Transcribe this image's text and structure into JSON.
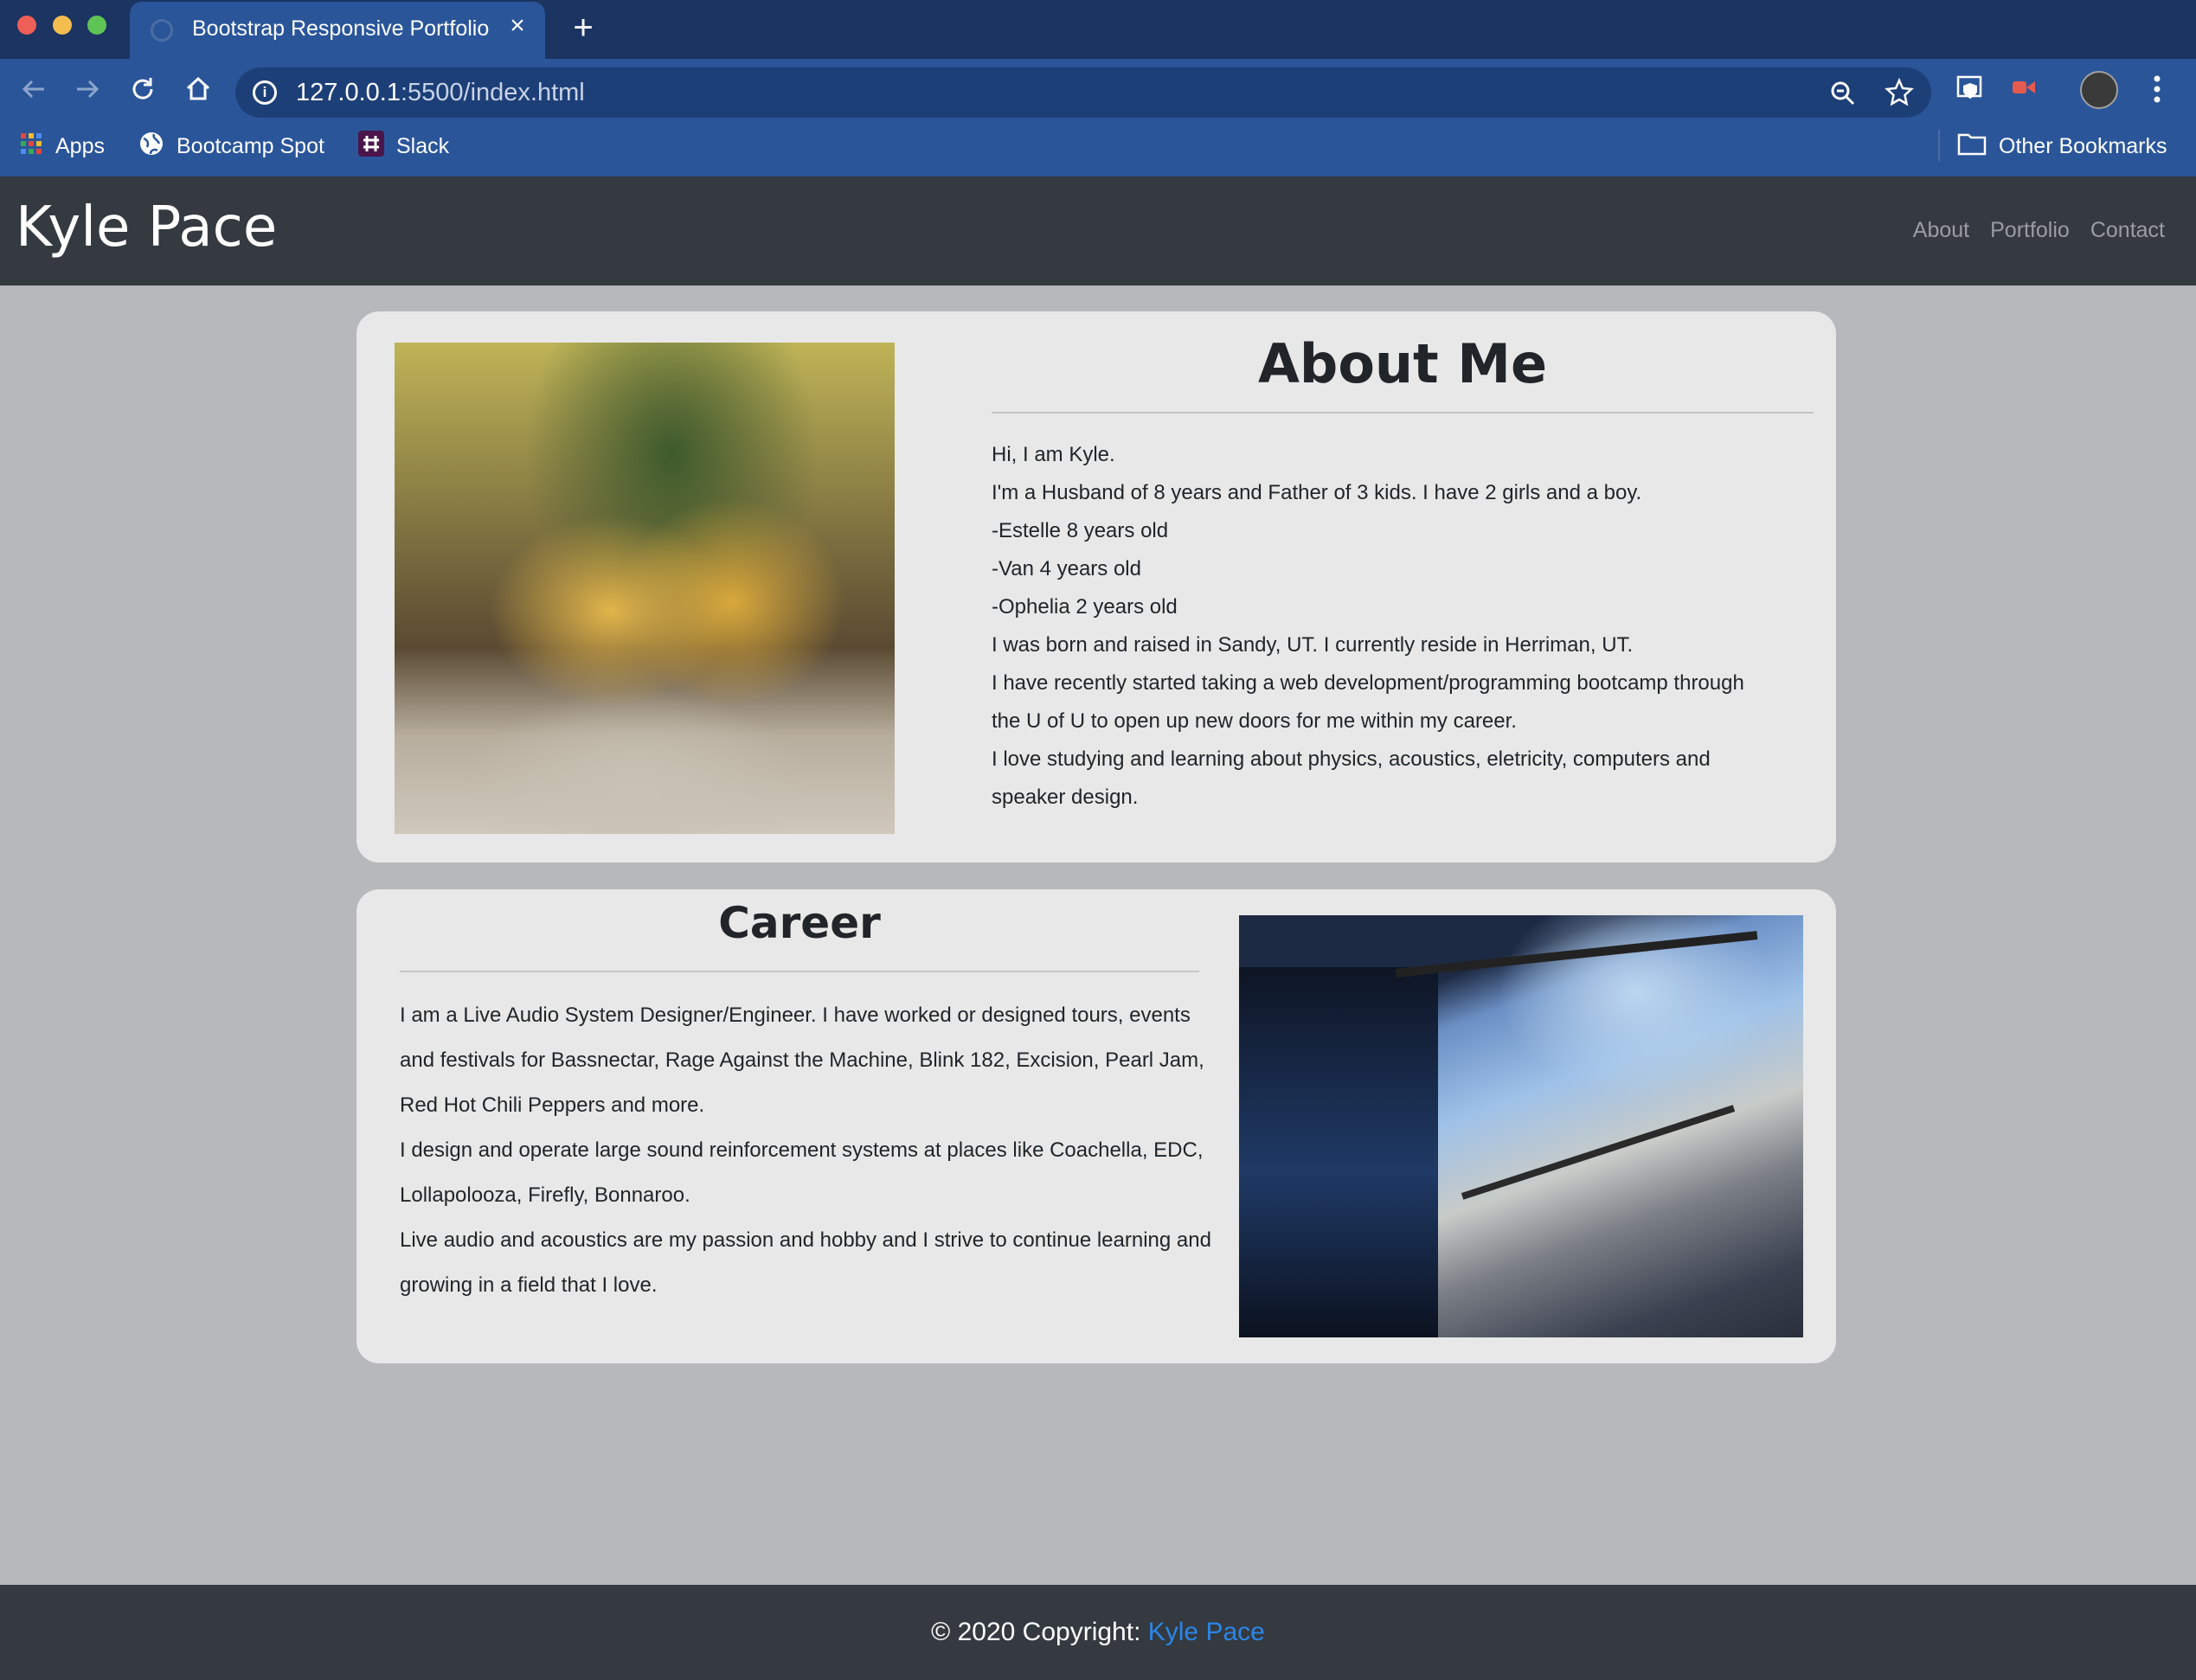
{
  "browser": {
    "tab_title": "Bootstrap Responsive Portfolio",
    "url_host": "127.0.0.1",
    "url_path": ":5500/index.html",
    "bookmarks": [
      {
        "label": "Apps",
        "icon": "apps-grid-icon"
      },
      {
        "label": "Bootcamp Spot",
        "icon": "globe-icon"
      },
      {
        "label": "Slack",
        "icon": "slack-icon"
      }
    ],
    "other_bookmarks": "Other Bookmarks"
  },
  "navbar": {
    "brand": "Kyle Pace",
    "links": [
      "About",
      "Portfolio",
      "Contact"
    ]
  },
  "about": {
    "title": "About Me",
    "photo_alt": "Three kids sitting in front of a Christmas tree",
    "lines": [
      "Hi, I am Kyle.",
      "I'm a Husband of 8 years and Father of 3 kids. I have 2 girls and a boy.",
      "-Estelle 8 years old",
      "-Van 4 years old",
      "-Ophelia 2 years old",
      "I was born and raised in Sandy, UT. I currently reside in Herriman, UT.",
      "I have recently started taking a web development/programming bootcamp through the U of U to open up new doors for me within my career.",
      "I love studying and learning about physics, acoustics, eletricity, computers and speaker design."
    ]
  },
  "career": {
    "title": "Career",
    "photo_alt": "Concert stage with speaker arrays in a stadium",
    "lines": [
      "I am a Live Audio System Designer/Engineer. I have worked or designed tours, events and festivals for Bassnectar, Rage Against the Machine, Blink 182, Excision, Pearl Jam, Red Hot Chili Peppers and more.",
      "I design and operate large sound reinforcement systems at places like Coachella, EDC, Lollapolooza, Firefly, Bonnaroo.",
      "Live audio and acoustics are my passion and hobby and I strive to continue learning and growing in a field that I love."
    ]
  },
  "footer": {
    "prefix": "© 2020 Copyright: ",
    "link": "Kyle Pace"
  },
  "colors": {
    "chrome_dark": "#1b3461",
    "chrome": "#2a5599",
    "navbar": "#343a40",
    "page_bg": "#b7b8bc",
    "card_bg": "#e8e8e8",
    "link": "#2a86e8"
  }
}
